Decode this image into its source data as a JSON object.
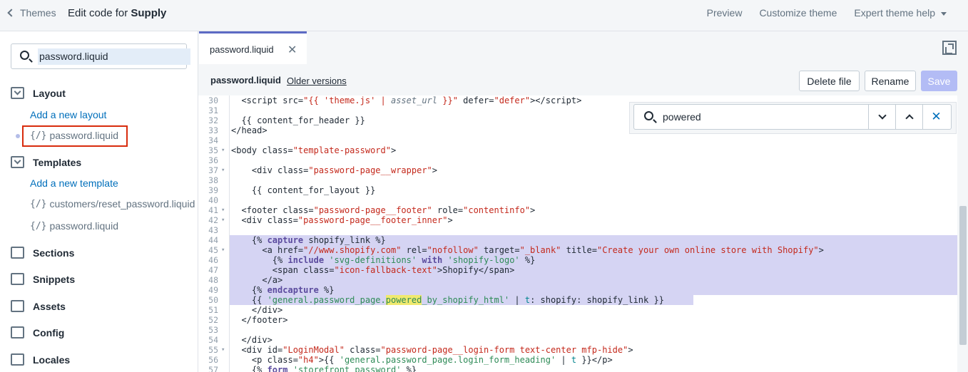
{
  "topbar": {
    "back_label": "Themes",
    "title_prefix": "Edit code for",
    "title_theme": "Supply",
    "actions": [
      "Preview",
      "Customize theme",
      "Expert theme help"
    ]
  },
  "sidebar": {
    "search_value": "password.liquid",
    "layout_label": "Layout",
    "add_layout": "Add a new layout",
    "layout_file": "password.liquid",
    "templates_label": "Templates",
    "add_template": "Add a new template",
    "template_files": [
      "customers/reset_password.liquid",
      "password.liquid"
    ],
    "sections": [
      "Sections",
      "Snippets",
      "Assets",
      "Config",
      "Locales"
    ],
    "file_glyph": "{/}"
  },
  "editor": {
    "tab_label": "password.liquid",
    "file_name": "password.liquid",
    "older_versions": "Older versions",
    "delete_label": "Delete file",
    "rename_label": "Rename",
    "save_label": "Save",
    "find_value": "powered"
  },
  "colors": {
    "accent": "#5c6ac4",
    "link": "#006fbb",
    "selection": "#d5d4f3",
    "match": "#f0e96f",
    "selected_outline": "#d82c0d"
  }
}
